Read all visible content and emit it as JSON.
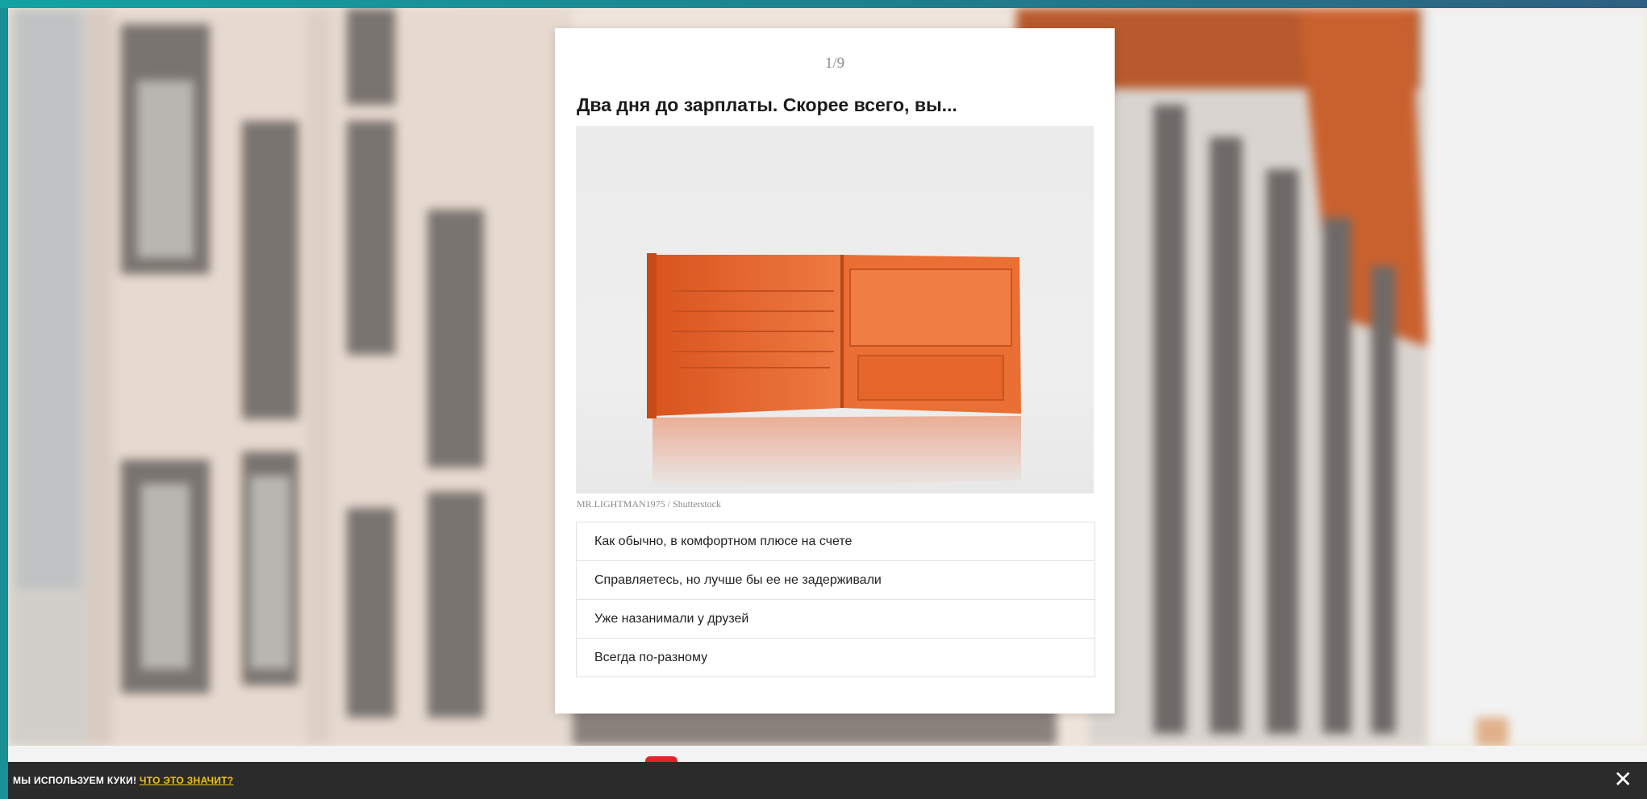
{
  "quiz": {
    "progress": "1/9",
    "question": "Два дня до зарплаты. Скорее всего, вы...",
    "image_description": "wallet-photo",
    "photo_credit": "MR.LIGHTMAN1975 / Shutterstock",
    "answers": [
      "Как обычно, в комфортном плюсе на счете",
      "Справляетесь, но лучше бы ее не задерживали",
      "Уже назанимали у друзей",
      "Всегда по-разному"
    ]
  },
  "cookie_bar": {
    "text": "МЫ ИСПОЛЬЗУЕМ КУКИ!",
    "link": "ЧТО ЭТО ЗНАЧИТ?",
    "close_icon": "close-icon"
  },
  "colors": {
    "accent_orange": "#e8622a",
    "cookie_bg": "#2b2b2b",
    "cookie_link": "#f0c419",
    "frame": "#1a8f95"
  }
}
